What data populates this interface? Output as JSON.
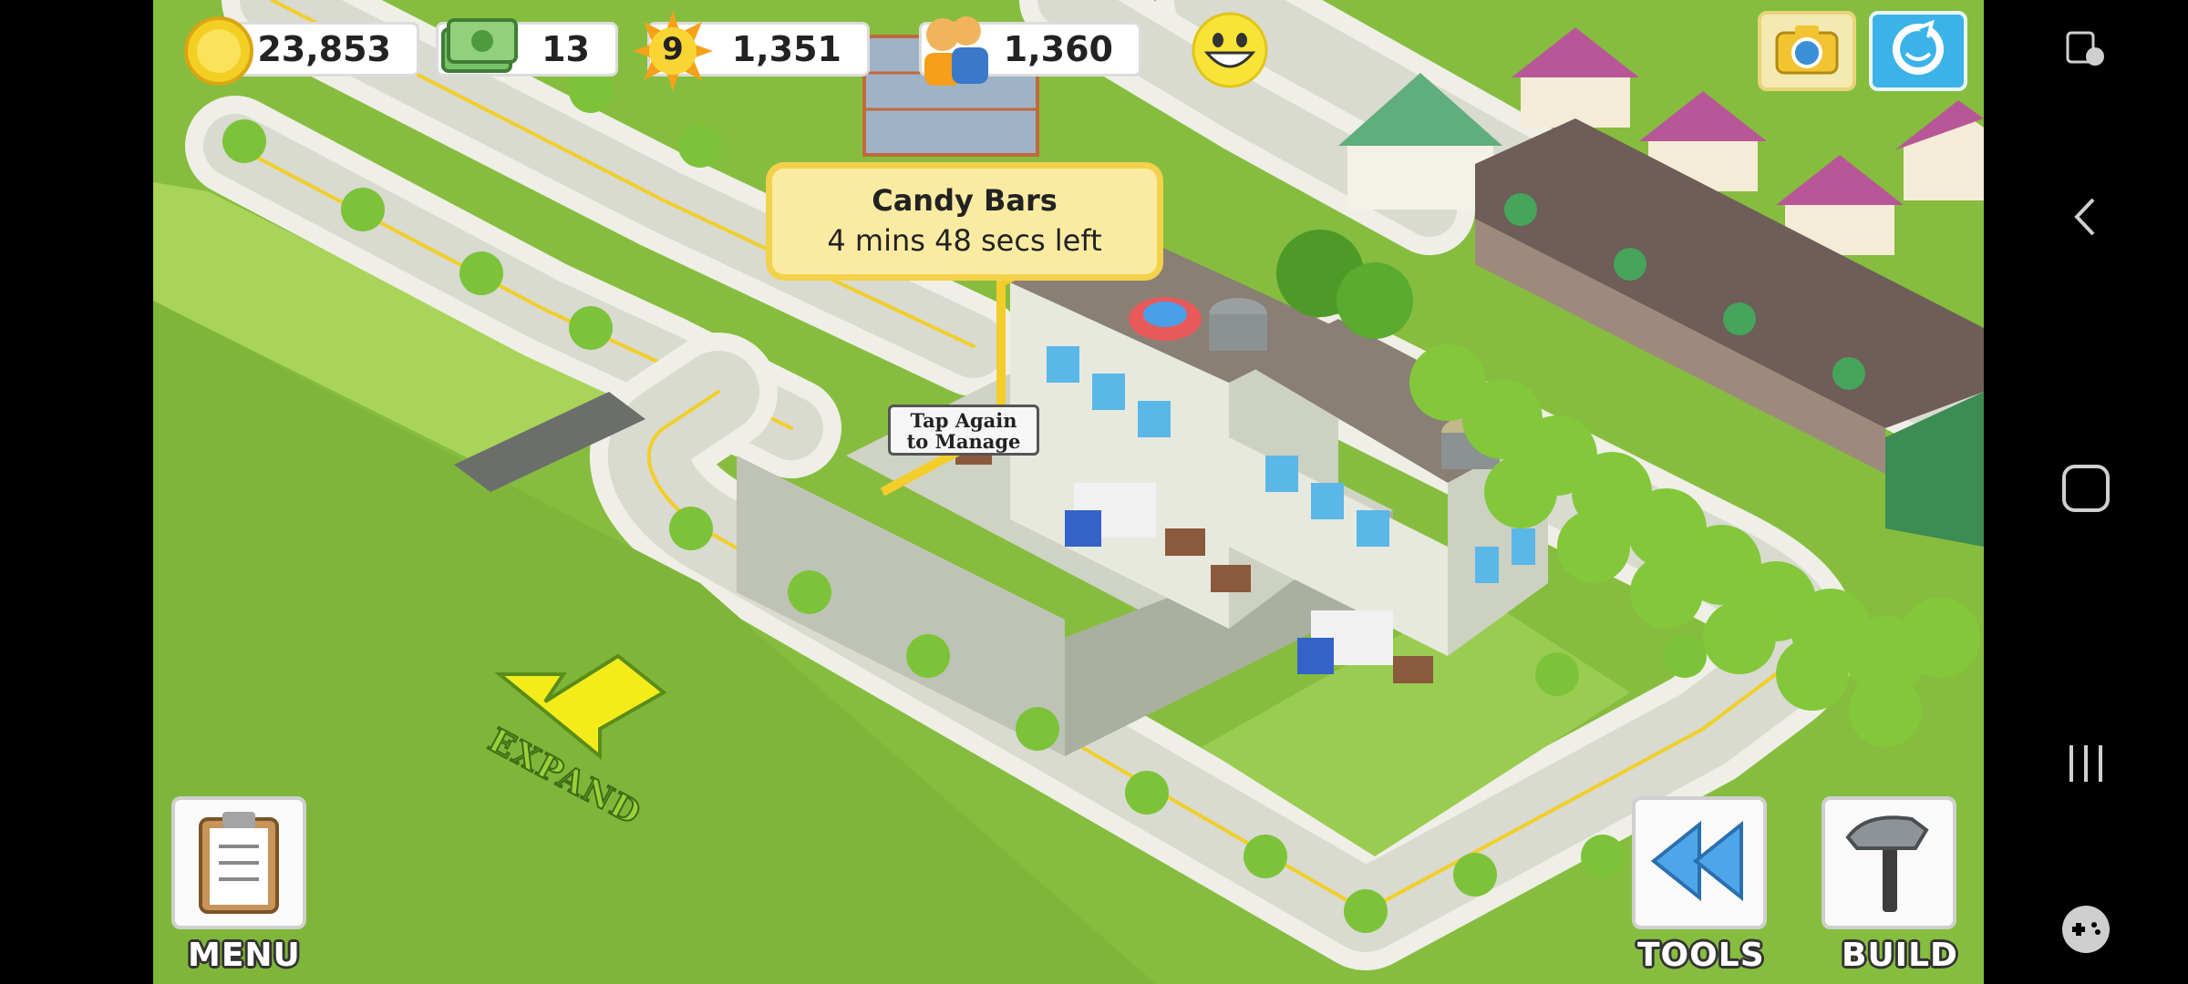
{
  "hud": {
    "coins": "23,853",
    "cash": "13",
    "level": "9",
    "xp": "1,351",
    "population": "1,360"
  },
  "tooltip": {
    "title": "Candy Bars",
    "subtitle": "4 mins 48 secs left"
  },
  "building_sign": {
    "line1": "Tap Again",
    "line2": "to Manage"
  },
  "expand_label": "EXPAND",
  "buttons": {
    "menu": "MENU",
    "tools": "TOOLS",
    "build": "BUILD"
  },
  "icons": {
    "coins": "gold-coin-icon",
    "cash": "cash-bills-icon",
    "level": "sun-level-icon",
    "population": "people-icon",
    "happiness": "smiley-face-icon",
    "camera": "camera-icon",
    "share": "share-icon",
    "menu": "clipboard-icon",
    "tools": "rewind-arrows-icon",
    "build": "hammer-icon"
  },
  "colors": {
    "grass": "#86bd3f",
    "road": "#e3e4dc",
    "tooltip_bg": "#fbeba2",
    "tooltip_border": "#f3d14a",
    "arrow": "#f3ec1a"
  }
}
